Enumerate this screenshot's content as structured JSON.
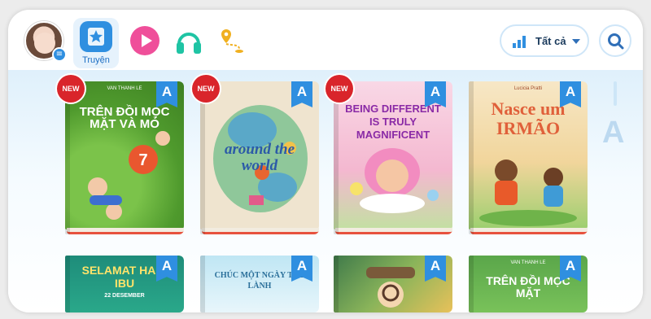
{
  "nav": {
    "active_tab_label": "Truyện",
    "icons": [
      "avatar",
      "book-star-icon",
      "play-icon",
      "headphones-icon",
      "map-route-icon"
    ]
  },
  "filter": {
    "label": "Tất cả",
    "icon": "bar-chart-icon"
  },
  "scroll_letter": "A",
  "colors": {
    "accent": "#2f8fe0",
    "new": "#d9252b",
    "play": "#ef4f9a",
    "headphones": "#1fc4a4",
    "map": "#f0b020"
  },
  "books_row1": [
    {
      "new": "NEW",
      "level": "A",
      "author": "VAN THANH LE",
      "title": "TRÊN ĐỒI MỌC MẶT VÀ MỎ",
      "number": "7"
    },
    {
      "new": "NEW",
      "level": "A",
      "author": "",
      "title": "around the world",
      "number": ""
    },
    {
      "new": "NEW",
      "level": "A",
      "author": "",
      "title": "BEING DIFFERENT IS TRULY MAGNIFICENT",
      "number": ""
    },
    {
      "new": "",
      "level": "A",
      "author": "Lucicia Pratti",
      "title": "Nasce um IRMÃO",
      "number": ""
    }
  ],
  "books_row2": [
    {
      "level": "A",
      "title": "SELAMAT HARI IBU",
      "subtitle": "22 DESEMBER"
    },
    {
      "level": "A",
      "title": "CHÚC MỘT NGÀY TỐT LÀNH",
      "subtitle": ""
    },
    {
      "level": "A",
      "title": "",
      "subtitle": ""
    },
    {
      "level": "A",
      "title": "TRÊN ĐỒI MỌC MẶT",
      "subtitle": "VAN THANH LE"
    }
  ]
}
